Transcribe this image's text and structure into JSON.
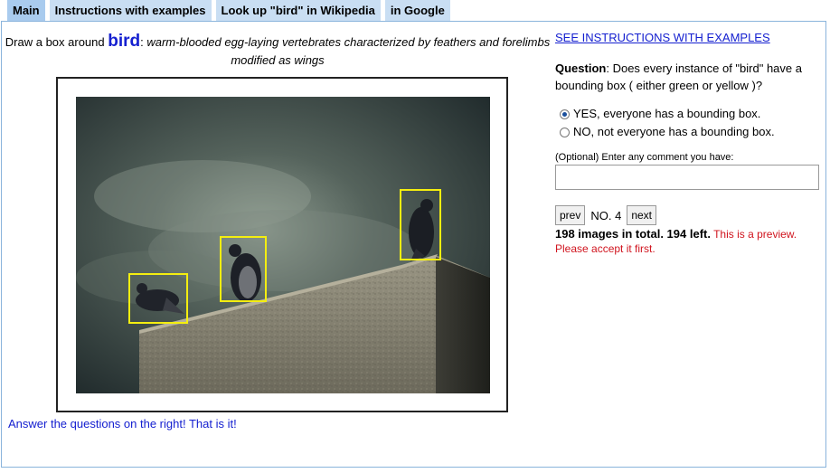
{
  "tabs": [
    "Main",
    "Instructions with examples",
    "Look up \"bird\" in Wikipedia",
    "in Google"
  ],
  "header": {
    "prefix": "Draw a box around ",
    "word": "bird",
    "definition": "warm-blooded egg-laying vertebrates characterized by feathers and forelimbs modified as wings"
  },
  "image_alt": "pigeons on a stone wall",
  "answer_text": "Answer the questions on the right! That is it!",
  "instructions_link": "SEE INSTRUCTIONS WITH EXAMPLES",
  "question": {
    "label": "Question",
    "text": "Does every instance of \"bird\" have a bounding box ( either green or yellow )?"
  },
  "options": [
    {
      "label": "YES, everyone has a bounding box.",
      "checked": true
    },
    {
      "label": "NO, not everyone has a bounding box.",
      "checked": false
    }
  ],
  "comment_label": "(Optional) Enter any comment you have:",
  "nav": {
    "prev": "prev",
    "counter": "NO. 4",
    "next": "next"
  },
  "stats": {
    "total": "198 images in total. 194 left.",
    "preview": "This is a preview.",
    "accept": "Please accept it first."
  },
  "colors": {
    "bbox": "#f4ee10",
    "accent": "#1520d0",
    "tab": "#c9def3"
  }
}
